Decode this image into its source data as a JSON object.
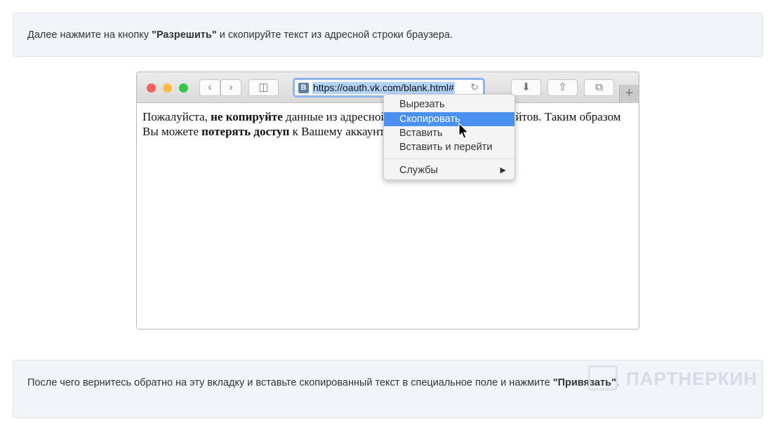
{
  "note1": {
    "before": "Далее нажмите на кнопку ",
    "bold": "\"Разрешить\"",
    "after": " и скопируйте текст из адресной строки браузера."
  },
  "browser": {
    "url": "https://oauth.vk.com/blank.html#",
    "favicon": "В",
    "new_tab": "+",
    "content": {
      "p1": "Пожалуйста, ",
      "b1": "не копируйте",
      "p2": " данные из адресной строки для сторонних сайтов. Таким образом Вы можете ",
      "b2": "потерять доступ",
      "p3": " к Вашему аккаунту."
    },
    "menu": {
      "items": [
        "Вырезать",
        "Скопировать",
        "Вставить",
        "Вставить и перейти",
        "Службы"
      ],
      "selected": "Скопировать"
    }
  },
  "note2": {
    "before": "После чего вернитесь обратно на эту вкладку и вставьте скопированный текст в специальное поле и нажмите ",
    "bold": "\"Привязать\"",
    "after": "."
  },
  "watermark": "ПАРТНЕРКИН"
}
